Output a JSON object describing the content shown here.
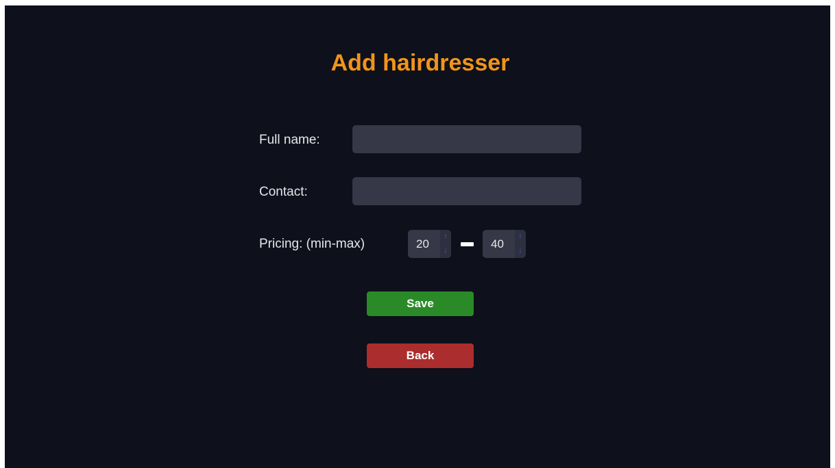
{
  "page": {
    "title": "Add hairdresser"
  },
  "form": {
    "full_name": {
      "label": "Full name:",
      "value": ""
    },
    "contact": {
      "label": "Contact:",
      "value": ""
    },
    "pricing": {
      "label": "Pricing: (min-max)",
      "min": "20",
      "max": "40",
      "up_icon": "arrow-up-icon",
      "down_icon": "arrow-down-icon"
    }
  },
  "buttons": {
    "save_label": "Save",
    "back_label": "Back"
  },
  "colors": {
    "background": "#0e101b",
    "title": "#f0951a",
    "input_bg": "#363847",
    "save": "#2a8a27",
    "back": "#ab2d2d",
    "spin_arrow": "#3e5cc8"
  }
}
